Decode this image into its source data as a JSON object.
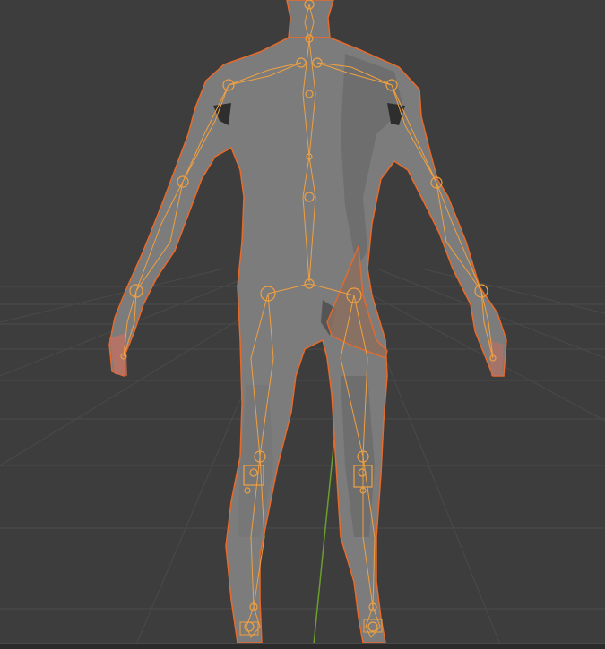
{
  "viewport": {
    "background_color": "#3d3d3d",
    "grid_color": "#4d4d4d",
    "y_axis_color": "#6b9e2e",
    "mesh_fill_color": "#7c7c7c",
    "mesh_shade_color": "#5e5e5e",
    "selection_outline_color": "#e86a2a",
    "armature_color": "#f0a040"
  },
  "scene": {
    "objects": [
      "character-mesh",
      "armature"
    ],
    "selected": "character-mesh",
    "y_axis_visible": true,
    "grid_visible": true
  }
}
